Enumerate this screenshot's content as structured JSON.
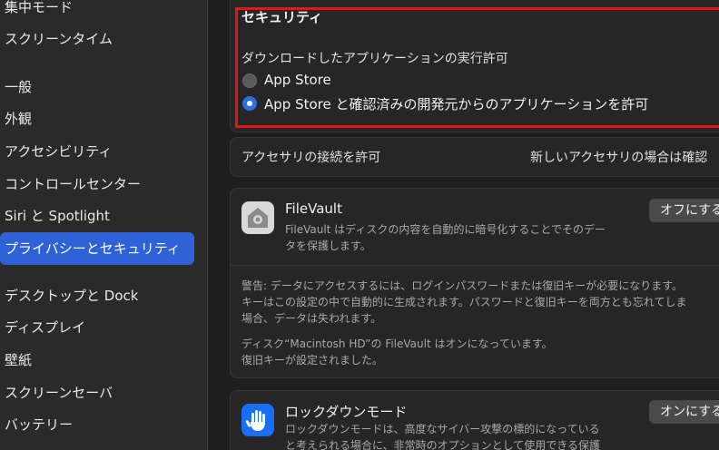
{
  "sidebar": {
    "items": [
      {
        "label": "集中モード"
      },
      {
        "label": "スクリーンタイム"
      },
      {
        "label": "一般"
      },
      {
        "label": "外観"
      },
      {
        "label": "アクセシビリティ"
      },
      {
        "label": "コントロールセンター"
      },
      {
        "label": "Siri と Spotlight"
      },
      {
        "label": "プライバシーとセキュリティ"
      },
      {
        "label": "デスクトップと Dock"
      },
      {
        "label": "ディスプレイ"
      },
      {
        "label": "壁紙"
      },
      {
        "label": "スクリーンセーバ"
      },
      {
        "label": "バッテリー"
      }
    ],
    "selected": "プライバシーとセキュリティ"
  },
  "security": {
    "heading": "セキュリティ",
    "download_label": "ダウンロードしたアプリケーションの実行許可",
    "options": [
      {
        "label": "App Store",
        "selected": false
      },
      {
        "label": "App Store と確認済みの開発元からのアプリケーションを許可",
        "selected": true
      }
    ]
  },
  "accessory": {
    "label": "アクセサリの接続を許可",
    "value": "新しいアクセサリの場合は確認"
  },
  "filevault": {
    "title": "FileVault",
    "description_line1": "FileVault はディスクの内容を自動的に暗号化することでそのデー",
    "description_line2": "タを保護します。",
    "button": "オフにする",
    "warning_line1": "警告: データにアクセスするには、ログインパスワードまたは復旧キーが必要になります。",
    "warning_line2": "キーはこの設定の中で自動的に生成されます。パスワードと復旧キーを両方とも忘れてしま",
    "warning_line3": "場合、データは失われます。",
    "status_line1": "ディスク“Macintosh HD”の FileVault はオンになっています。",
    "status_line2": "復旧キーが設定されました。"
  },
  "lockdown": {
    "title": "ロックダウンモード",
    "description_line1": "ロックダウンモードは、高度なサイバー攻撃の標的になっている",
    "description_line2": "と考えられる場合に、非常時のオプションとして使用できる保護",
    "button": "オンにする"
  },
  "colors": {
    "accent": "#2f62d6",
    "highlight_border": "#e3161b",
    "lockdown_icon": "#1a6ef5"
  }
}
